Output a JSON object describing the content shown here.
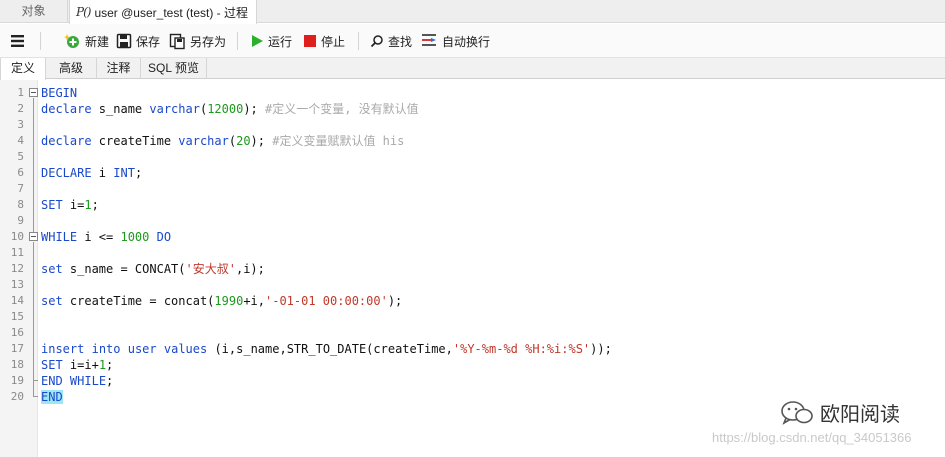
{
  "tabs": {
    "objects_label": "对象",
    "active_icon_text": "P()",
    "active_label": "user @user_test (test) - 过程"
  },
  "toolbar": {
    "menu_icon": "hamburger-icon",
    "new_label": "新建",
    "save_label": "保存",
    "save_as_label": "另存为",
    "run_label": "运行",
    "stop_label": "停止",
    "find_label": "查找",
    "wrap_label": "自动换行"
  },
  "subtabs": [
    "定义",
    "高级",
    "注释",
    "SQL 预览"
  ],
  "editor": {
    "line_numbers": [
      "1",
      "2",
      "3",
      "4",
      "5",
      "6",
      "7",
      "8",
      "9",
      "10",
      "11",
      "12",
      "13",
      "14",
      "15",
      "16",
      "17",
      "18",
      "19",
      "20"
    ],
    "lines": {
      "l1": {
        "kw1": "BEGIN"
      },
      "l2": {
        "kw1": "declare",
        "t1": " s_name ",
        "kw2": "varchar",
        "t2": "(",
        "n1": "12000",
        "t3": "); ",
        "c1": "#定义一个变量, 没有默认值"
      },
      "l4": {
        "kw1": "declare",
        "t1": " createTime ",
        "kw2": "varchar",
        "t2": "(",
        "n1": "20",
        "t3": "); ",
        "c1": "#定义变量赋默认值 his"
      },
      "l6": {
        "kw1": "DECLARE",
        "t1": " i ",
        "kw2": "INT",
        "t2": ";"
      },
      "l8": {
        "kw1": "SET",
        "t1": " i=",
        "n1": "1",
        "t2": ";"
      },
      "l10": {
        "kw1": "WHILE",
        "t1": " i <= ",
        "n1": "1000",
        "t2": " ",
        "kw2": "DO"
      },
      "l12": {
        "kw1": "set",
        "t1": " s_name = CONCAT(",
        "s1": "'安大叔'",
        "t2": ",i);"
      },
      "l14": {
        "kw1": "set",
        "t1": " createTime = concat(",
        "n1": "1990",
        "t2": "+i,",
        "s1": "'-01-01 00:00:00'",
        "t3": ");"
      },
      "l17": {
        "kw1": "insert",
        "t1": " ",
        "kw2": "into",
        "t2": " ",
        "kw3": "user",
        "t3": " ",
        "kw4": "values",
        "t4": " (i,s_name,STR_TO_DATE(createTime,",
        "s1": "'%Y-%m-%d %H:%i:%S'",
        "t5": "));"
      },
      "l18": {
        "kw1": "SET",
        "t1": " i=i+",
        "n1": "1",
        "t2": ";"
      },
      "l19": {
        "kw1": "END",
        "t1": " ",
        "kw2": "WHILE",
        "t2": ";"
      },
      "l20": {
        "kw1": "END"
      }
    }
  },
  "watermark": {
    "brand": "欧阳阅读",
    "url": "https://blog.csdn.net/qq_34051366"
  },
  "colors": {
    "keyword": "#1a49c9",
    "number": "#1c9a1c",
    "string": "#c0392b",
    "comment": "#a9a9a9",
    "highlight": "#9ee6f5"
  }
}
